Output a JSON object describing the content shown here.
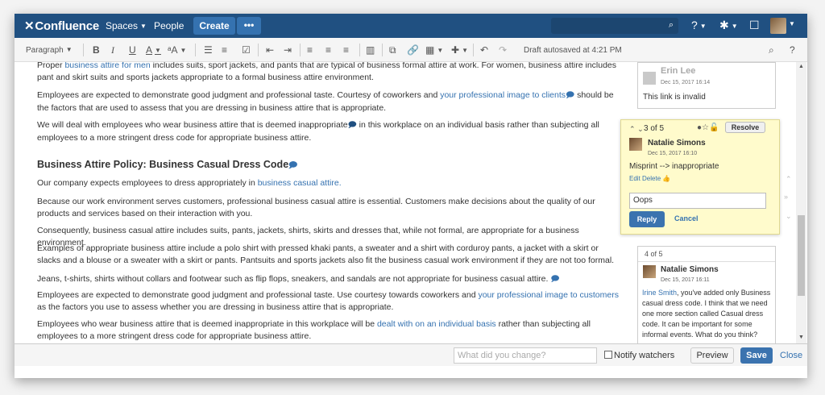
{
  "nav": {
    "logo": "Confluence",
    "spaces": "Spaces",
    "people": "People",
    "create": "Create",
    "more": "•••",
    "help_icon": "help-icon",
    "settings_icon": "gear-icon",
    "notifications_icon": "bell-icon"
  },
  "toolbar": {
    "paragraph": "Paragraph",
    "bold": "B",
    "italic": "I",
    "underline": "U",
    "text_color": "A",
    "font_size": "ᵃA",
    "autosave": "Draft autosaved at 4:21 PM"
  },
  "content": {
    "p1_a": "Proper ",
    "p1_link": "business attire for men",
    "p1_b": " includes suits, sport jackets, and pants that are typical of business formal attire at work. For women, business attire includes pant and skirt suits and sports jackets appropriate to a formal business attire environment.",
    "p2_a": "Employees are expected to demonstrate good judgment and professional taste. Courtesy of coworkers and ",
    "p2_link": "your professional image to clients",
    "p2_b": " should be the factors that are used to assess that you are dressing in business attire that is appropriate.",
    "p3_a": "We will deal with employees who wear business attire that is deemed inappropriate",
    "p3_b": " in this workplace on an individual basis rather than subjecting all employees to a more stringent dress code for appropriate business attire.",
    "heading": "Business Attire Policy: Business Casual Dress Code",
    "p4_a": "Our company expects employees to dress appropriately in ",
    "p4_link": "business casual attire.",
    "p5": "Because our work environment serves customers, professional business casual attire is essential. Customers make decisions about the quality of our products and services based on their interaction with you.",
    "p6": "Consequently, business casual attire includes suits, pants, jackets, shirts, skirts and dresses that, while not formal, are appropriate for a business environment.",
    "p7": "Examples of appropriate business attire include a polo shirt with pressed khaki pants, a sweater and a shirt with corduroy pants, a jacket with a skirt or slacks and a blouse or a sweater with a skirt or pants. Pantsuits and sports jackets also fit the business casual work environment if they are not too formal.",
    "p8": "Jeans, t-shirts, shirts without collars and footwear such as flip flops, sneakers, and sandals are not appropriate for business casual attire.",
    "p9_a": "Employees are expected to demonstrate good judgment and professional taste. Use courtesy towards coworkers and ",
    "p9_link": "your professional image to customers",
    "p9_b": " as the factors you use to assess whether you are dressing in business attire that is appropriate.",
    "p10_a": "Employees who wear business attire that is deemed inappropriate in this workplace will be ",
    "p10_link": "dealt with on an individual basis",
    "p10_b": " rather than subjecting all employees to a more stringent dress code for appropriate business attire."
  },
  "comments": {
    "old": {
      "name": "Erin Lee",
      "date": "Dec 15, 2017 16:14",
      "text": "This link is invalid"
    },
    "active": {
      "count": "3 of 5",
      "resolve": "Resolve",
      "name": "Natalie Simons",
      "date": "Dec 15, 2017 16:10",
      "text": "Misprint --> inappropriate",
      "edit": "Edit",
      "delete": "Delete",
      "reply_value": "Oops",
      "reply_btn": "Reply",
      "cancel_btn": "Cancel"
    },
    "fourth": {
      "count": "4 of 5",
      "name": "Natalie Simons",
      "date": "Dec 15, 2017 16:11",
      "mention": "Irine Smith",
      "text": ", you've added only Business casual dress code. I think that we need one more section called Casual dress code. It can be important for some informal events. What do you think?"
    }
  },
  "footer": {
    "change_placeholder": "What did you change?",
    "notify": "Notify watchers",
    "preview": "Preview",
    "save": "Save",
    "close": "Close"
  },
  "colors": {
    "nav_bg": "#205081",
    "primary": "#3b73af",
    "link": "#3572b0",
    "comment_bg": "#fffbcc"
  }
}
